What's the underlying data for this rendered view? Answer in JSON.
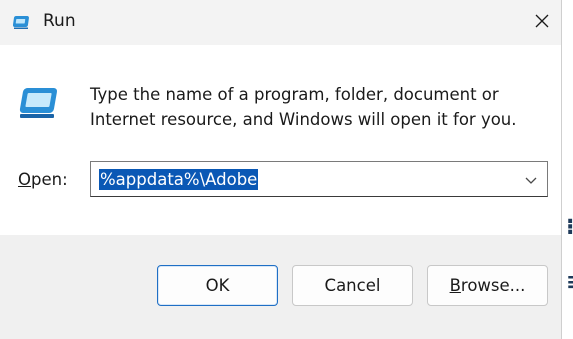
{
  "window": {
    "title": "Run",
    "close_label": "Close"
  },
  "dialog": {
    "description_line1": "Type the name of a program, folder, document or",
    "description_line2": "Internet resource, and Windows will open it for you.",
    "open_label_mnemonic": "O",
    "open_label_rest": "pen:",
    "open_value": "%appdata%\\Adobe"
  },
  "buttons": {
    "ok": "OK",
    "cancel": "Cancel",
    "browse_mnemonic": "B",
    "browse_rest": "rowse..."
  },
  "icons": {
    "app": "run-icon",
    "dialog": "run-icon",
    "close": "close-icon",
    "dropdown": "chevron-down-icon"
  },
  "colors": {
    "accent": "#0a58b5",
    "titlebar": "#f3f3f3",
    "footer": "#f0f0f0",
    "ok_border": "#1f6fc5"
  }
}
